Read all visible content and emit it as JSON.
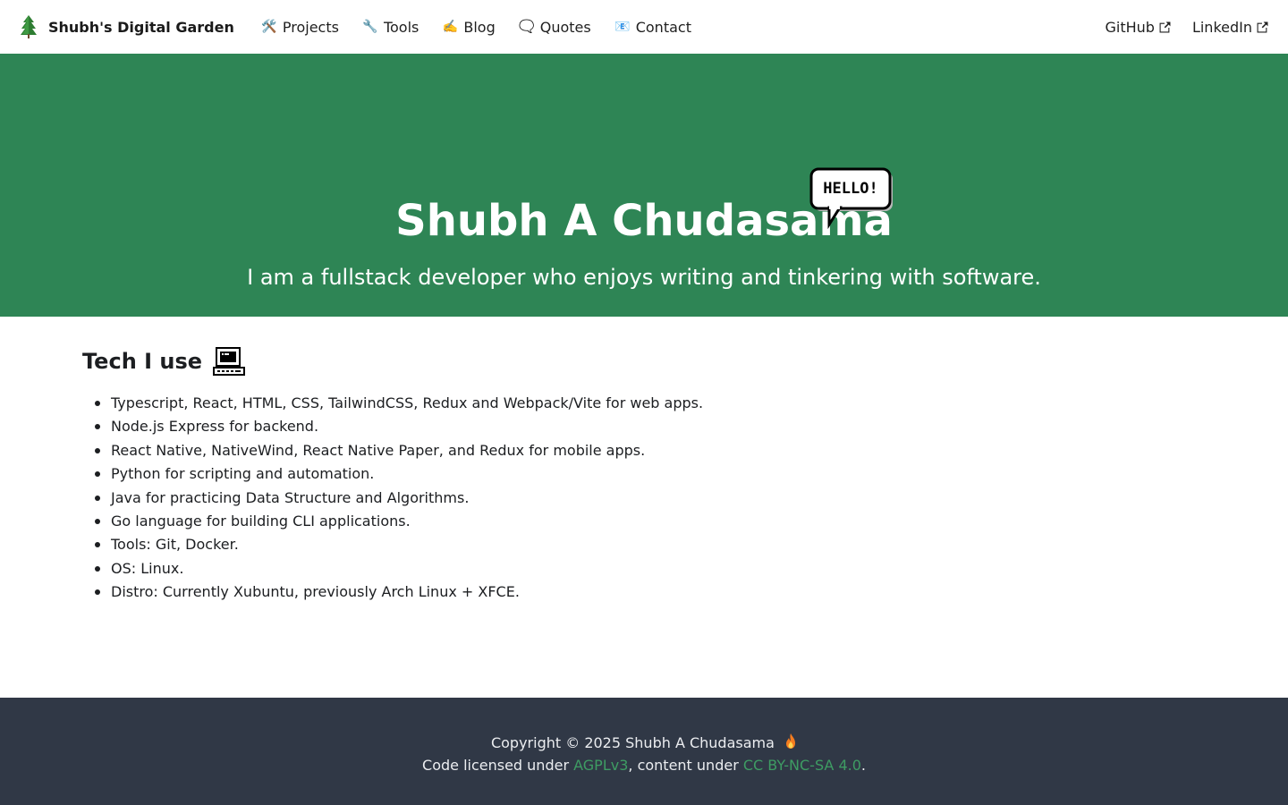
{
  "nav": {
    "brand": "Shubh's Digital Garden",
    "items": [
      {
        "icon": "tools-icon",
        "emoji": "🛠️",
        "label": "Projects"
      },
      {
        "icon": "wrench-icon",
        "emoji": "🔧",
        "label": "Tools"
      },
      {
        "icon": "writing-hand-icon",
        "emoji": "✍️",
        "label": "Blog"
      },
      {
        "icon": "speech-bubble-icon",
        "emoji": "🗨️",
        "label": "Quotes"
      },
      {
        "icon": "email-icon",
        "emoji": "📧",
        "label": "Contact"
      }
    ],
    "external": [
      {
        "label": "GitHub",
        "icon": "external-link-icon"
      },
      {
        "label": "LinkedIn",
        "icon": "external-link-icon"
      }
    ]
  },
  "hero": {
    "title": "Shubh A Chudasama",
    "bubble_text": "HELLO!",
    "subtitle": "I am a fullstack developer who enjoys writing and tinkering with software."
  },
  "tech": {
    "heading": "Tech I use",
    "items": [
      "Typescript, React, HTML, CSS, TailwindCSS, Redux and Webpack/Vite for web apps.",
      "Node.js Express for backend.",
      "React Native, NativeWind, React Native Paper, and Redux for mobile apps.",
      "Python for scripting and automation.",
      "Java for practicing Data Structure and Algorithms.",
      "Go language for building CLI applications.",
      "Tools: Git, Docker.",
      "OS: Linux.",
      "Distro: Currently Xubuntu, previously Arch Linux + XFCE."
    ]
  },
  "footer": {
    "copyright": "Copyright © 2025 Shubh A Chudasama",
    "code_prefix": "Code licensed under ",
    "code_license": "AGPLv3",
    "content_prefix": ", content under ",
    "content_license": "CC BY-NC-SA 4.0",
    "suffix": "."
  },
  "colors": {
    "hero_bg": "#2e8555",
    "footer_bg": "#303846",
    "link": "#3e9c63"
  }
}
